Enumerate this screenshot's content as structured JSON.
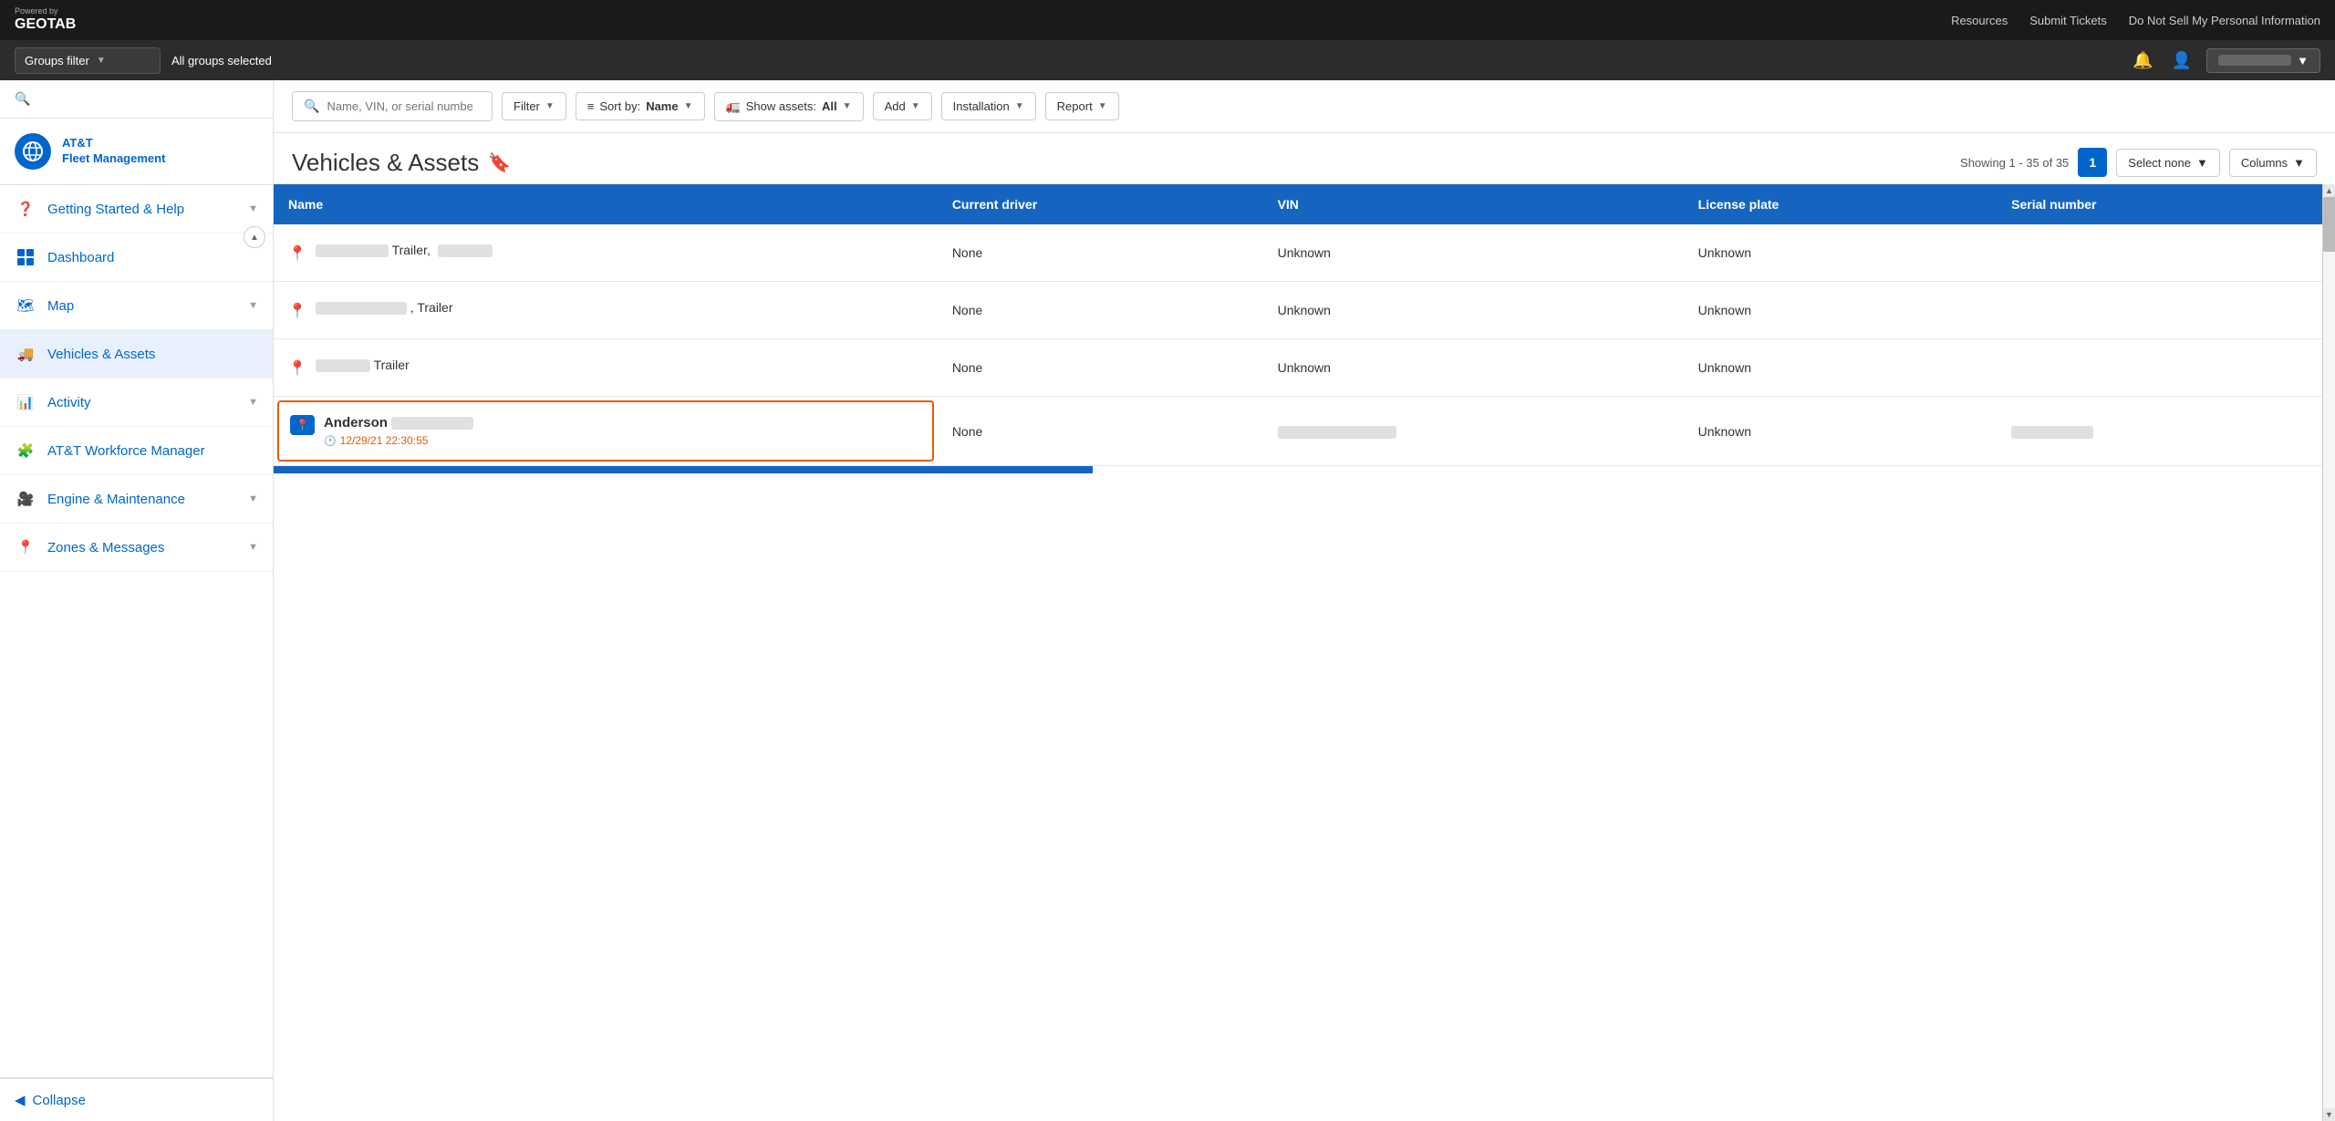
{
  "topNav": {
    "poweredBy": "Powered by",
    "brand": "GEOTAB",
    "links": [
      "Resources",
      "Submit Tickets",
      "Do Not Sell My Personal Information"
    ]
  },
  "groupsBar": {
    "filterLabel": "Groups filter",
    "selectedText": "All groups selected"
  },
  "sidebar": {
    "searchPlaceholder": "Search",
    "logoTitle": "AT&T\nFleet Management",
    "logoLine1": "AT&T",
    "logoLine2": "Fleet Management",
    "items": [
      {
        "id": "getting-started",
        "label": "Getting Started & Help",
        "hasChevron": true,
        "active": false
      },
      {
        "id": "dashboard",
        "label": "Dashboard",
        "hasChevron": false,
        "active": false
      },
      {
        "id": "map",
        "label": "Map",
        "hasChevron": true,
        "active": false
      },
      {
        "id": "vehicles-assets",
        "label": "Vehicles & Assets",
        "hasChevron": false,
        "active": true
      },
      {
        "id": "activity",
        "label": "Activity",
        "hasChevron": true,
        "active": false
      },
      {
        "id": "att-workforce",
        "label": "AT&T Workforce Manager",
        "hasChevron": false,
        "active": false
      },
      {
        "id": "engine-maintenance",
        "label": "Engine & Maintenance",
        "hasChevron": true,
        "active": false
      },
      {
        "id": "zones-messages",
        "label": "Zones & Messages",
        "hasChevron": true,
        "active": false
      }
    ],
    "collapseLabel": "Collapse"
  },
  "toolbar": {
    "searchPlaceholder": "Name, VIN, or serial number",
    "filterLabel": "Filter",
    "sortLabel": "Sort by:",
    "sortValue": "Name",
    "showAssetsLabel": "Show assets:",
    "showAssetsValue": "All",
    "addLabel": "Add",
    "installationLabel": "Installation",
    "reportLabel": "Report"
  },
  "pageHeader": {
    "title": "Vehicles & Assets",
    "showingText": "Showing 1 - 35 of 35",
    "pageNum": "1",
    "selectNoneLabel": "Select none",
    "columnsLabel": "Columns"
  },
  "tableHeaders": [
    "Name",
    "Current driver",
    "VIN",
    "License plate",
    "Serial number"
  ],
  "tableRows": [
    {
      "id": "row-1",
      "nameIcon": "pin",
      "nameText": "Trailer,",
      "nameRedacted": true,
      "nameRedactedWidth": 80,
      "driver": "None",
      "vin": "Unknown",
      "licensePlate": "Unknown",
      "serialNumber": ""
    },
    {
      "id": "row-2",
      "nameIcon": "pin",
      "nameText": ", Trailer",
      "nameRedacted": true,
      "nameRedactedWidth": 100,
      "driver": "None",
      "vin": "Unknown",
      "licensePlate": "Unknown",
      "serialNumber": ""
    },
    {
      "id": "row-3",
      "nameIcon": "pin",
      "nameText": "Trailer",
      "nameRedacted": true,
      "nameRedactedWidth": 60,
      "driver": "None",
      "vin": "Unknown",
      "licensePlate": "Unknown",
      "serialNumber": ""
    },
    {
      "id": "row-anderson",
      "nameIcon": "location-blue",
      "nameMain": "Anderson",
      "nameRedacted": true,
      "nameRedactedWidth": 90,
      "timestamp": "12/29/21 22:30:55",
      "driver": "None",
      "vin": "",
      "vinRedacted": true,
      "vinRedactedWidth": 130,
      "licensePlate": "Unknown",
      "serialNumber": "",
      "serialRedacted": true,
      "serialRedactedWidth": 90,
      "highlighted": true
    }
  ],
  "colors": {
    "tableHeaderBg": "#1565c0",
    "activeBg": "#e8f0fe",
    "brandBlue": "#0066cc",
    "highlightBorder": "#e65c00"
  }
}
